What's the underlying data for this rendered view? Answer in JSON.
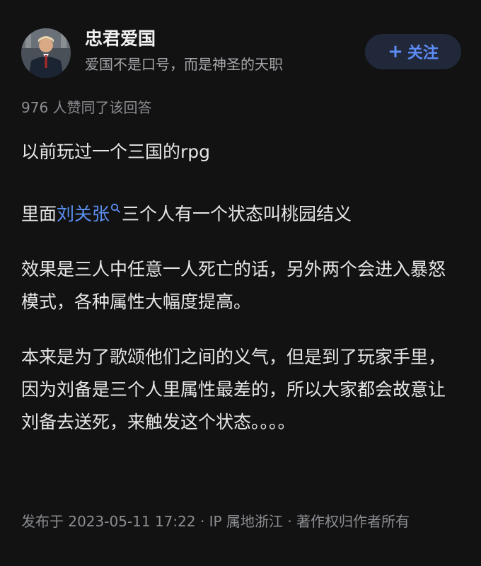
{
  "author": {
    "name": "忠君爱国",
    "bio": "爱国不是口号，而是神圣的天职",
    "follow_label": "关注"
  },
  "answer": {
    "likes_text": "976 人赞同了该回答",
    "paragraphs": {
      "p1": "以前玩过一个三国的rpg",
      "p2_before": "里面",
      "p2_link": "刘关张",
      "p2_after": "三个人有一个状态叫桃园结义",
      "p3": "效果是三人中任意一人死亡的话，另外两个会进入暴怒模式，各种属性大幅度提高。",
      "p4": "本来是为了歌颂他们之间的义气，但是到了玩家手里，因为刘备是三个人里属性最差的，所以大家都会故意让刘备去送死，来触发这个状态。。。。"
    },
    "footer": "发布于 2023-05-11 17:22 · IP 属地浙江 · 著作权归作者所有"
  },
  "colors": {
    "background": "#121212",
    "link": "#5b8ff0",
    "follow_button_bg": "#20283a",
    "follow_button_text": "#5d8cf7"
  },
  "icons": {
    "avatar": "person-portrait",
    "follow": "plus-icon",
    "search_mark": "search-icon"
  }
}
